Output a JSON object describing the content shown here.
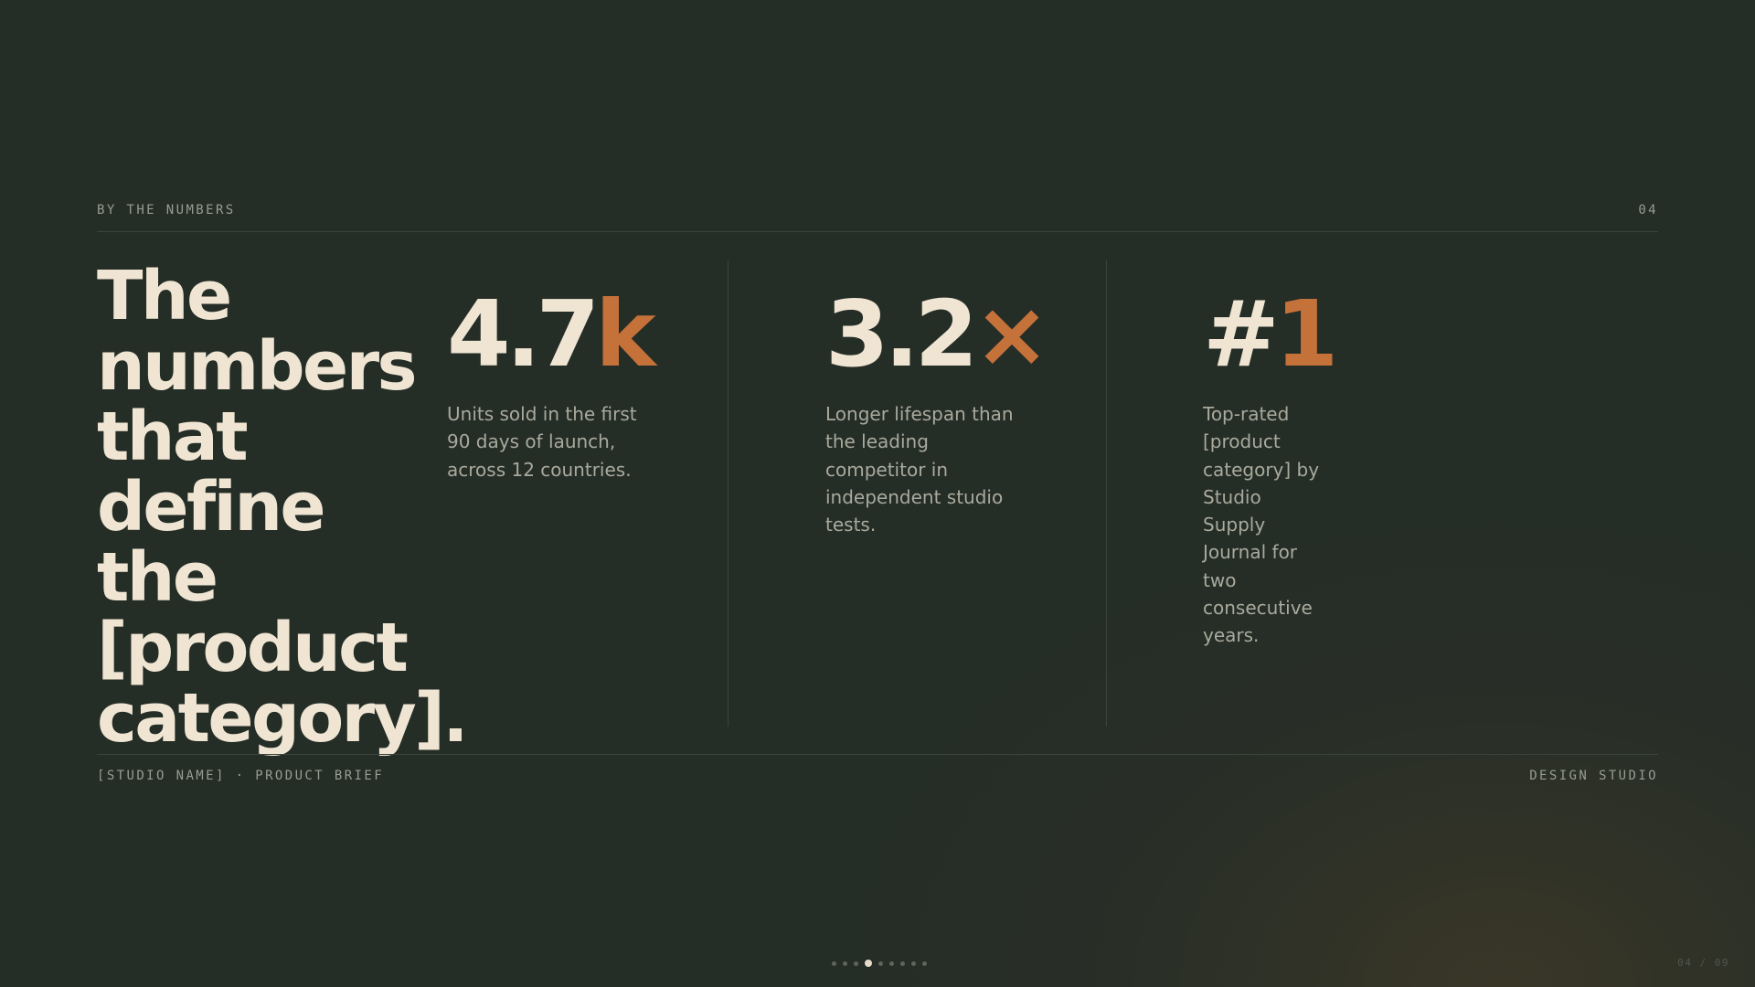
{
  "header": {
    "section_label": "BY THE NUMBERS",
    "slide_number": "04"
  },
  "headline": "The numbers that define the [product category].",
  "stats": [
    {
      "value": "4.7",
      "accent": "k",
      "description": "Units sold in the first 90 days of launch, across 12 countries."
    },
    {
      "value": "3.2",
      "accent": "×",
      "description": "Longer lifespan than the leading competitor in independent studio tests."
    },
    {
      "value": "#",
      "accent": "1",
      "description": "Top-rated [product category] by Studio Supply Journal for two consecutive years."
    }
  ],
  "footer": {
    "left_label": "[STUDIO NAME] · PRODUCT BRIEF",
    "right_label": "DESIGN STUDIO"
  },
  "pagination": {
    "total": 9,
    "current": 4,
    "counter": "04 / 09"
  },
  "colors": {
    "background": "#252d27",
    "accent": "#c4713a",
    "text": "#efe5d2",
    "muted": "#a9aa9c"
  }
}
